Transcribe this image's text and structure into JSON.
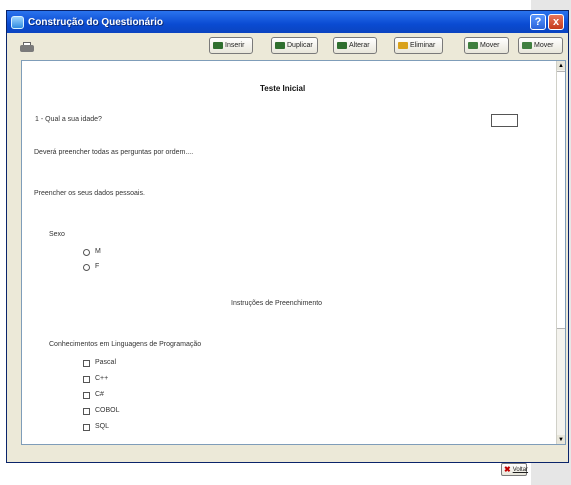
{
  "window": {
    "title": "Construção do Questionário",
    "help_glyph": "?",
    "close_glyph": "x"
  },
  "toolbar": {
    "buttons": [
      {
        "label": "Inserir",
        "icon": "insert-icon"
      },
      {
        "label": "Duplicar",
        "icon": "duplicate-icon"
      },
      {
        "label": "Alterar",
        "icon": "edit-icon"
      },
      {
        "label": "Eliminar",
        "icon": "delete-icon"
      },
      {
        "label": "Mover",
        "icon": "move-up-icon"
      },
      {
        "label": "Mover",
        "icon": "move-down-icon"
      }
    ]
  },
  "form": {
    "title": "Teste Inicial",
    "q1": "1 - Qual a sua idade?",
    "note1": "Deverá preencher todas as perguntas por ordem....",
    "note2": "Preencher os seus dados pessoais.",
    "sexo_label": "Sexo",
    "sexo_options": [
      "M",
      "F"
    ],
    "instructions": "Instruções de Preenchimento",
    "conhecimentos_label": "Conhecimentos em Linguagens de Programação",
    "languages": [
      "Pascal",
      "C++",
      "C#",
      "COBOL",
      "SQL"
    ]
  },
  "footer": {
    "back_label": "Voltar"
  },
  "colors": {
    "titlebar": "#0a4bd2",
    "window_bg": "#ece9d8",
    "close": "#c43a1c"
  }
}
